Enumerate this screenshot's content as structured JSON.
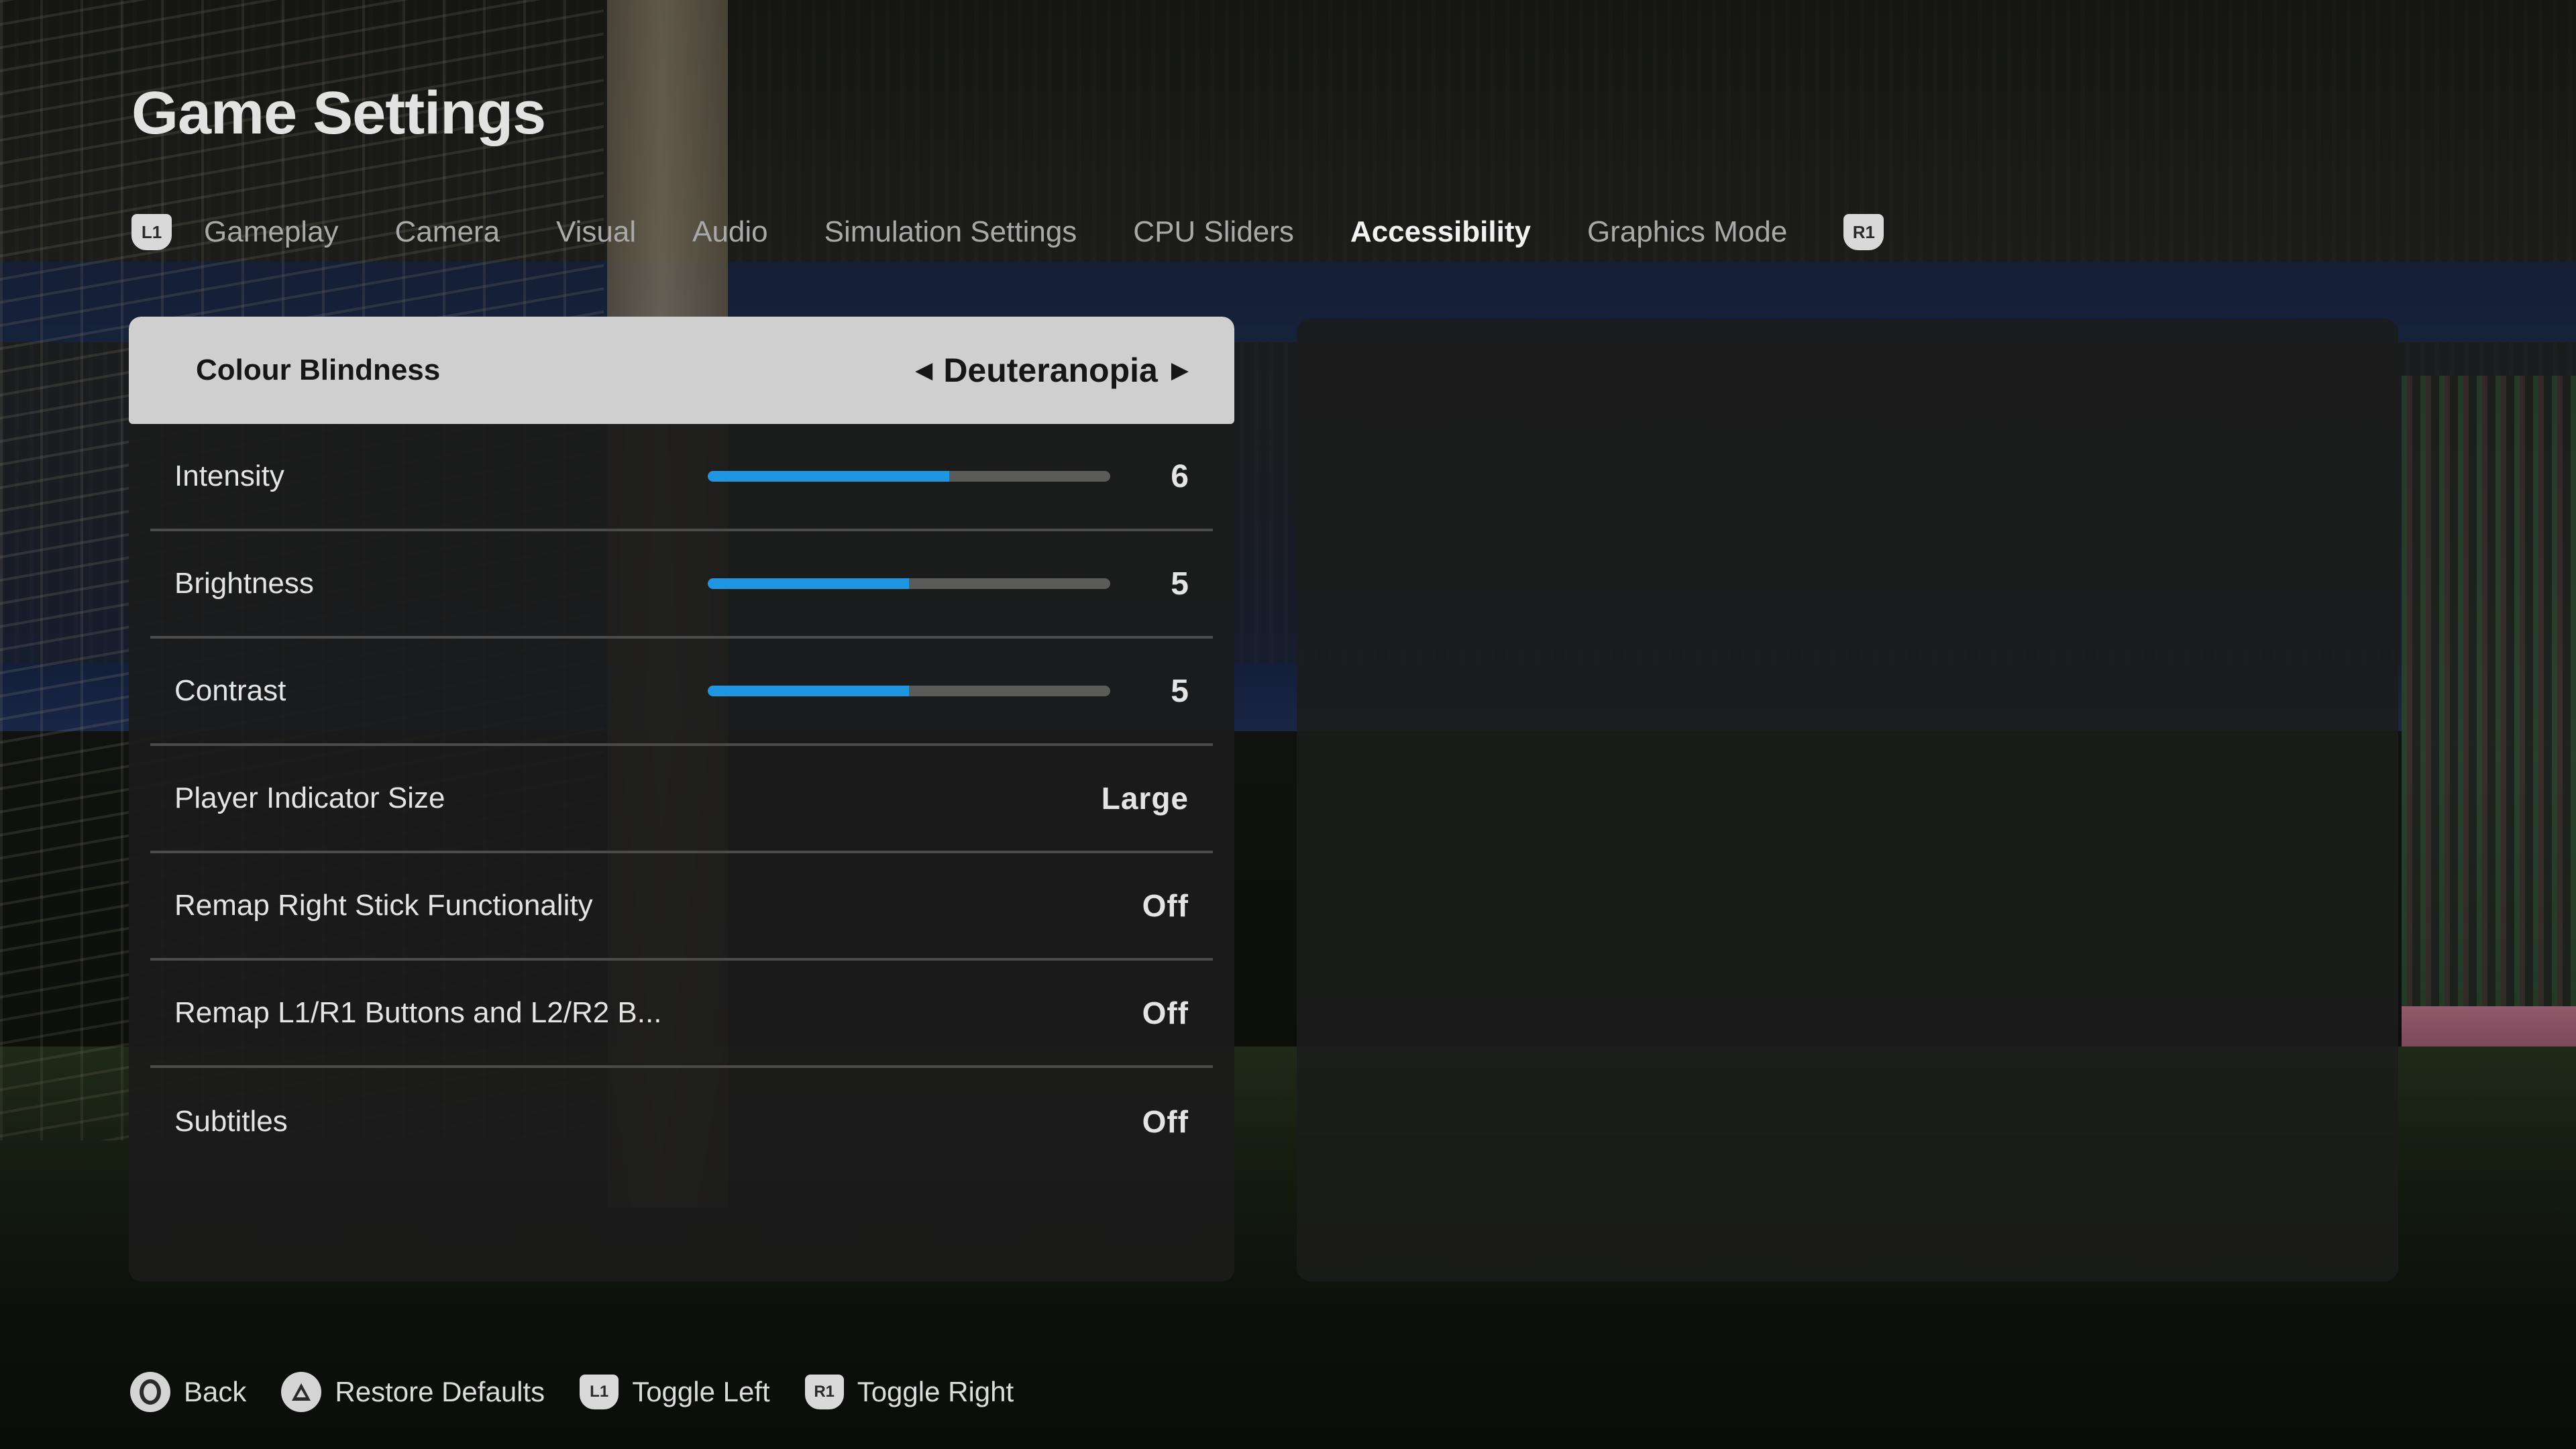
{
  "header": {
    "title": "Game Settings"
  },
  "tabs": {
    "left_badge": "L1",
    "right_badge": "R1",
    "items": [
      {
        "label": "Gameplay",
        "active": false
      },
      {
        "label": "Camera",
        "active": false
      },
      {
        "label": "Visual",
        "active": false
      },
      {
        "label": "Audio",
        "active": false
      },
      {
        "label": "Simulation Settings",
        "active": false
      },
      {
        "label": "CPU Sliders",
        "active": false
      },
      {
        "label": "Accessibility",
        "active": true
      },
      {
        "label": "Graphics Mode",
        "active": false
      }
    ]
  },
  "settings": {
    "colour_blindness": {
      "label": "Colour Blindness",
      "value": "Deuteranopia",
      "prev_icon": "triangle-left-icon",
      "next_icon": "triangle-right-icon"
    },
    "intensity": {
      "label": "Intensity",
      "value": "6",
      "fraction": 0.6
    },
    "brightness": {
      "label": "Brightness",
      "value": "5",
      "fraction": 0.5
    },
    "contrast": {
      "label": "Contrast",
      "value": "5",
      "fraction": 0.5
    },
    "player_indicator_size": {
      "label": "Player Indicator Size",
      "value": "Large"
    },
    "remap_right_stick": {
      "label": "Remap Right Stick Functionality",
      "value": "Off"
    },
    "remap_buttons": {
      "label": "Remap L1/R1 Buttons and L2/R2 B...",
      "value": "Off"
    },
    "subtitles": {
      "label": "Subtitles",
      "value": "Off"
    }
  },
  "footer": {
    "back": {
      "icon": "circle-button-icon",
      "label": "Back"
    },
    "restore": {
      "icon": "triangle-button-icon",
      "label": "Restore Defaults"
    },
    "toggle_left": {
      "badge": "L1",
      "label": "Toggle Left"
    },
    "toggle_right": {
      "badge": "R1",
      "label": "Toggle Right"
    }
  },
  "colors": {
    "slider_fill": "#1f96e0",
    "slider_track": "#5a5a58",
    "selected_row": "#cfcfcf",
    "panel": "#1b1b1b"
  }
}
